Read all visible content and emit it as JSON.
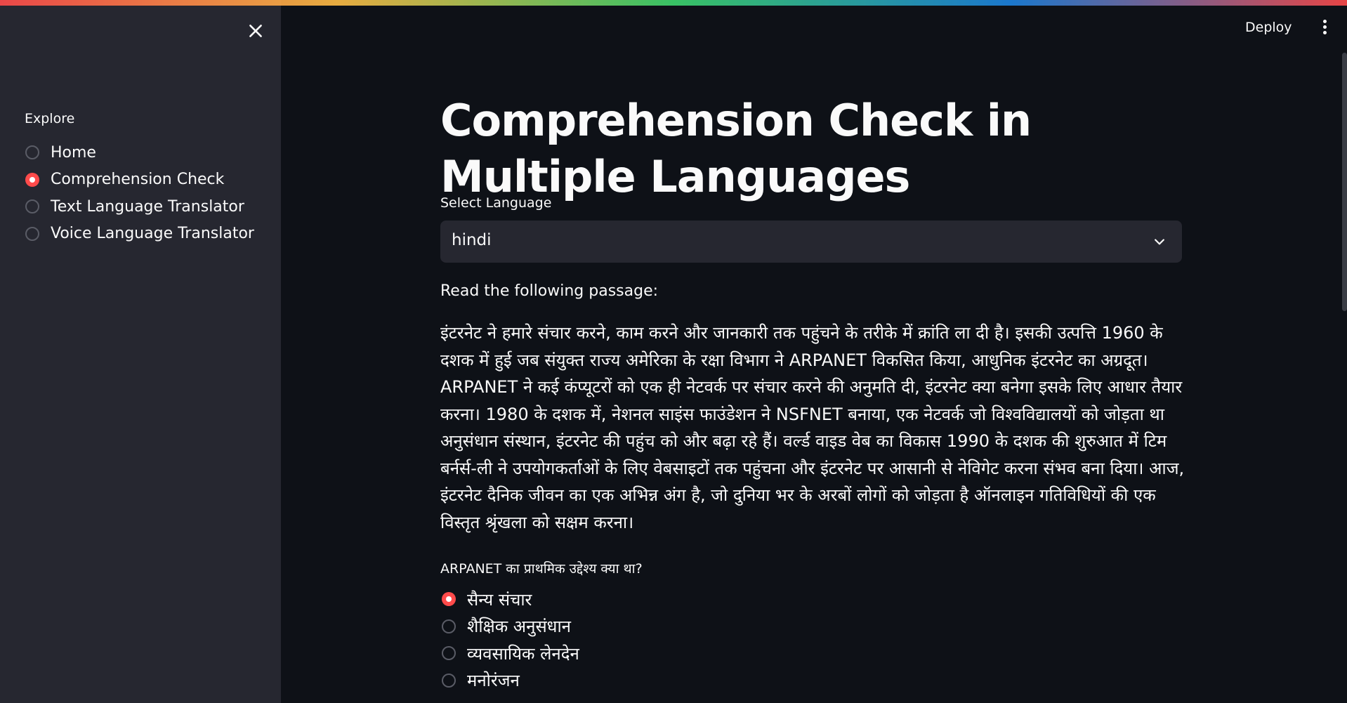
{
  "header": {
    "deploy_label": "Deploy",
    "menu_icon": "kebab-menu-icon"
  },
  "sidebar": {
    "close_icon": "close-icon",
    "section_label": "Explore",
    "selected_index": 1,
    "items": [
      {
        "label": "Home",
        "selected": false
      },
      {
        "label": "Comprehension Check",
        "selected": true
      },
      {
        "label": "Text Language Translator",
        "selected": false
      },
      {
        "label": "Voice Language Translator",
        "selected": false
      }
    ]
  },
  "main": {
    "title": "Comprehension Check in Multiple Languages",
    "select": {
      "label": "Select Language",
      "value": "hindi",
      "icon": "chevron-down-icon"
    },
    "passage_label": "Read the following passage:",
    "passage": "इंटरनेट ने हमारे संचार करने, काम करने और जानकारी तक पहुंचने के तरीके में क्रांति ला दी है। इसकी उत्पत्ति 1960 के दशक में हुई जब संयुक्त राज्य अमेरिका के रक्षा विभाग ने ARPANET विकसित किया, आधुनिक इंटरनेट का अग्रदूत। ARPANET ने कई कंप्यूटरों को एक ही नेटवर्क पर संचार करने की अनुमति दी, इंटरनेट क्या बनेगा इसके लिए आधार तैयार करना। 1980 के दशक में, नेशनल साइंस फाउंडेशन ने NSFNET बनाया, एक नेटवर्क जो विश्वविद्यालयों को जोड़ता था अनुसंधान संस्थान, इंटरनेट की पहुंच को और बढ़ा रहे हैं। वर्ल्ड वाइड वेब का विकास 1990 के दशक की शुरुआत में टिम बर्नर्स-ली ने उपयोगकर्ताओं के लिए वेबसाइटों तक पहुंचना और इंटरनेट पर आसानी से नेविगेट करना संभव बना दिया। आज, इंटरनेट दैनिक जीवन का एक अभिन्न अंग है, जो दुनिया भर के अरबों लोगों को जोड़ता है ऑनलाइन गतिविधियों की एक विस्तृत श्रृंखला को सक्षम करना।",
    "question": "ARPANET का प्राथमिक उद्देश्य क्या था?",
    "options": [
      {
        "label": "सैन्य संचार",
        "selected": true
      },
      {
        "label": "शैक्षिक अनुसंधान",
        "selected": false
      },
      {
        "label": "व्यवसायिक लेनदेन",
        "selected": false
      },
      {
        "label": "मनोरंजन",
        "selected": false
      }
    ]
  },
  "colors": {
    "background": "#0e1117",
    "sidebar": "#262730",
    "accent": "#ff4b4b",
    "text": "#fafafa"
  }
}
